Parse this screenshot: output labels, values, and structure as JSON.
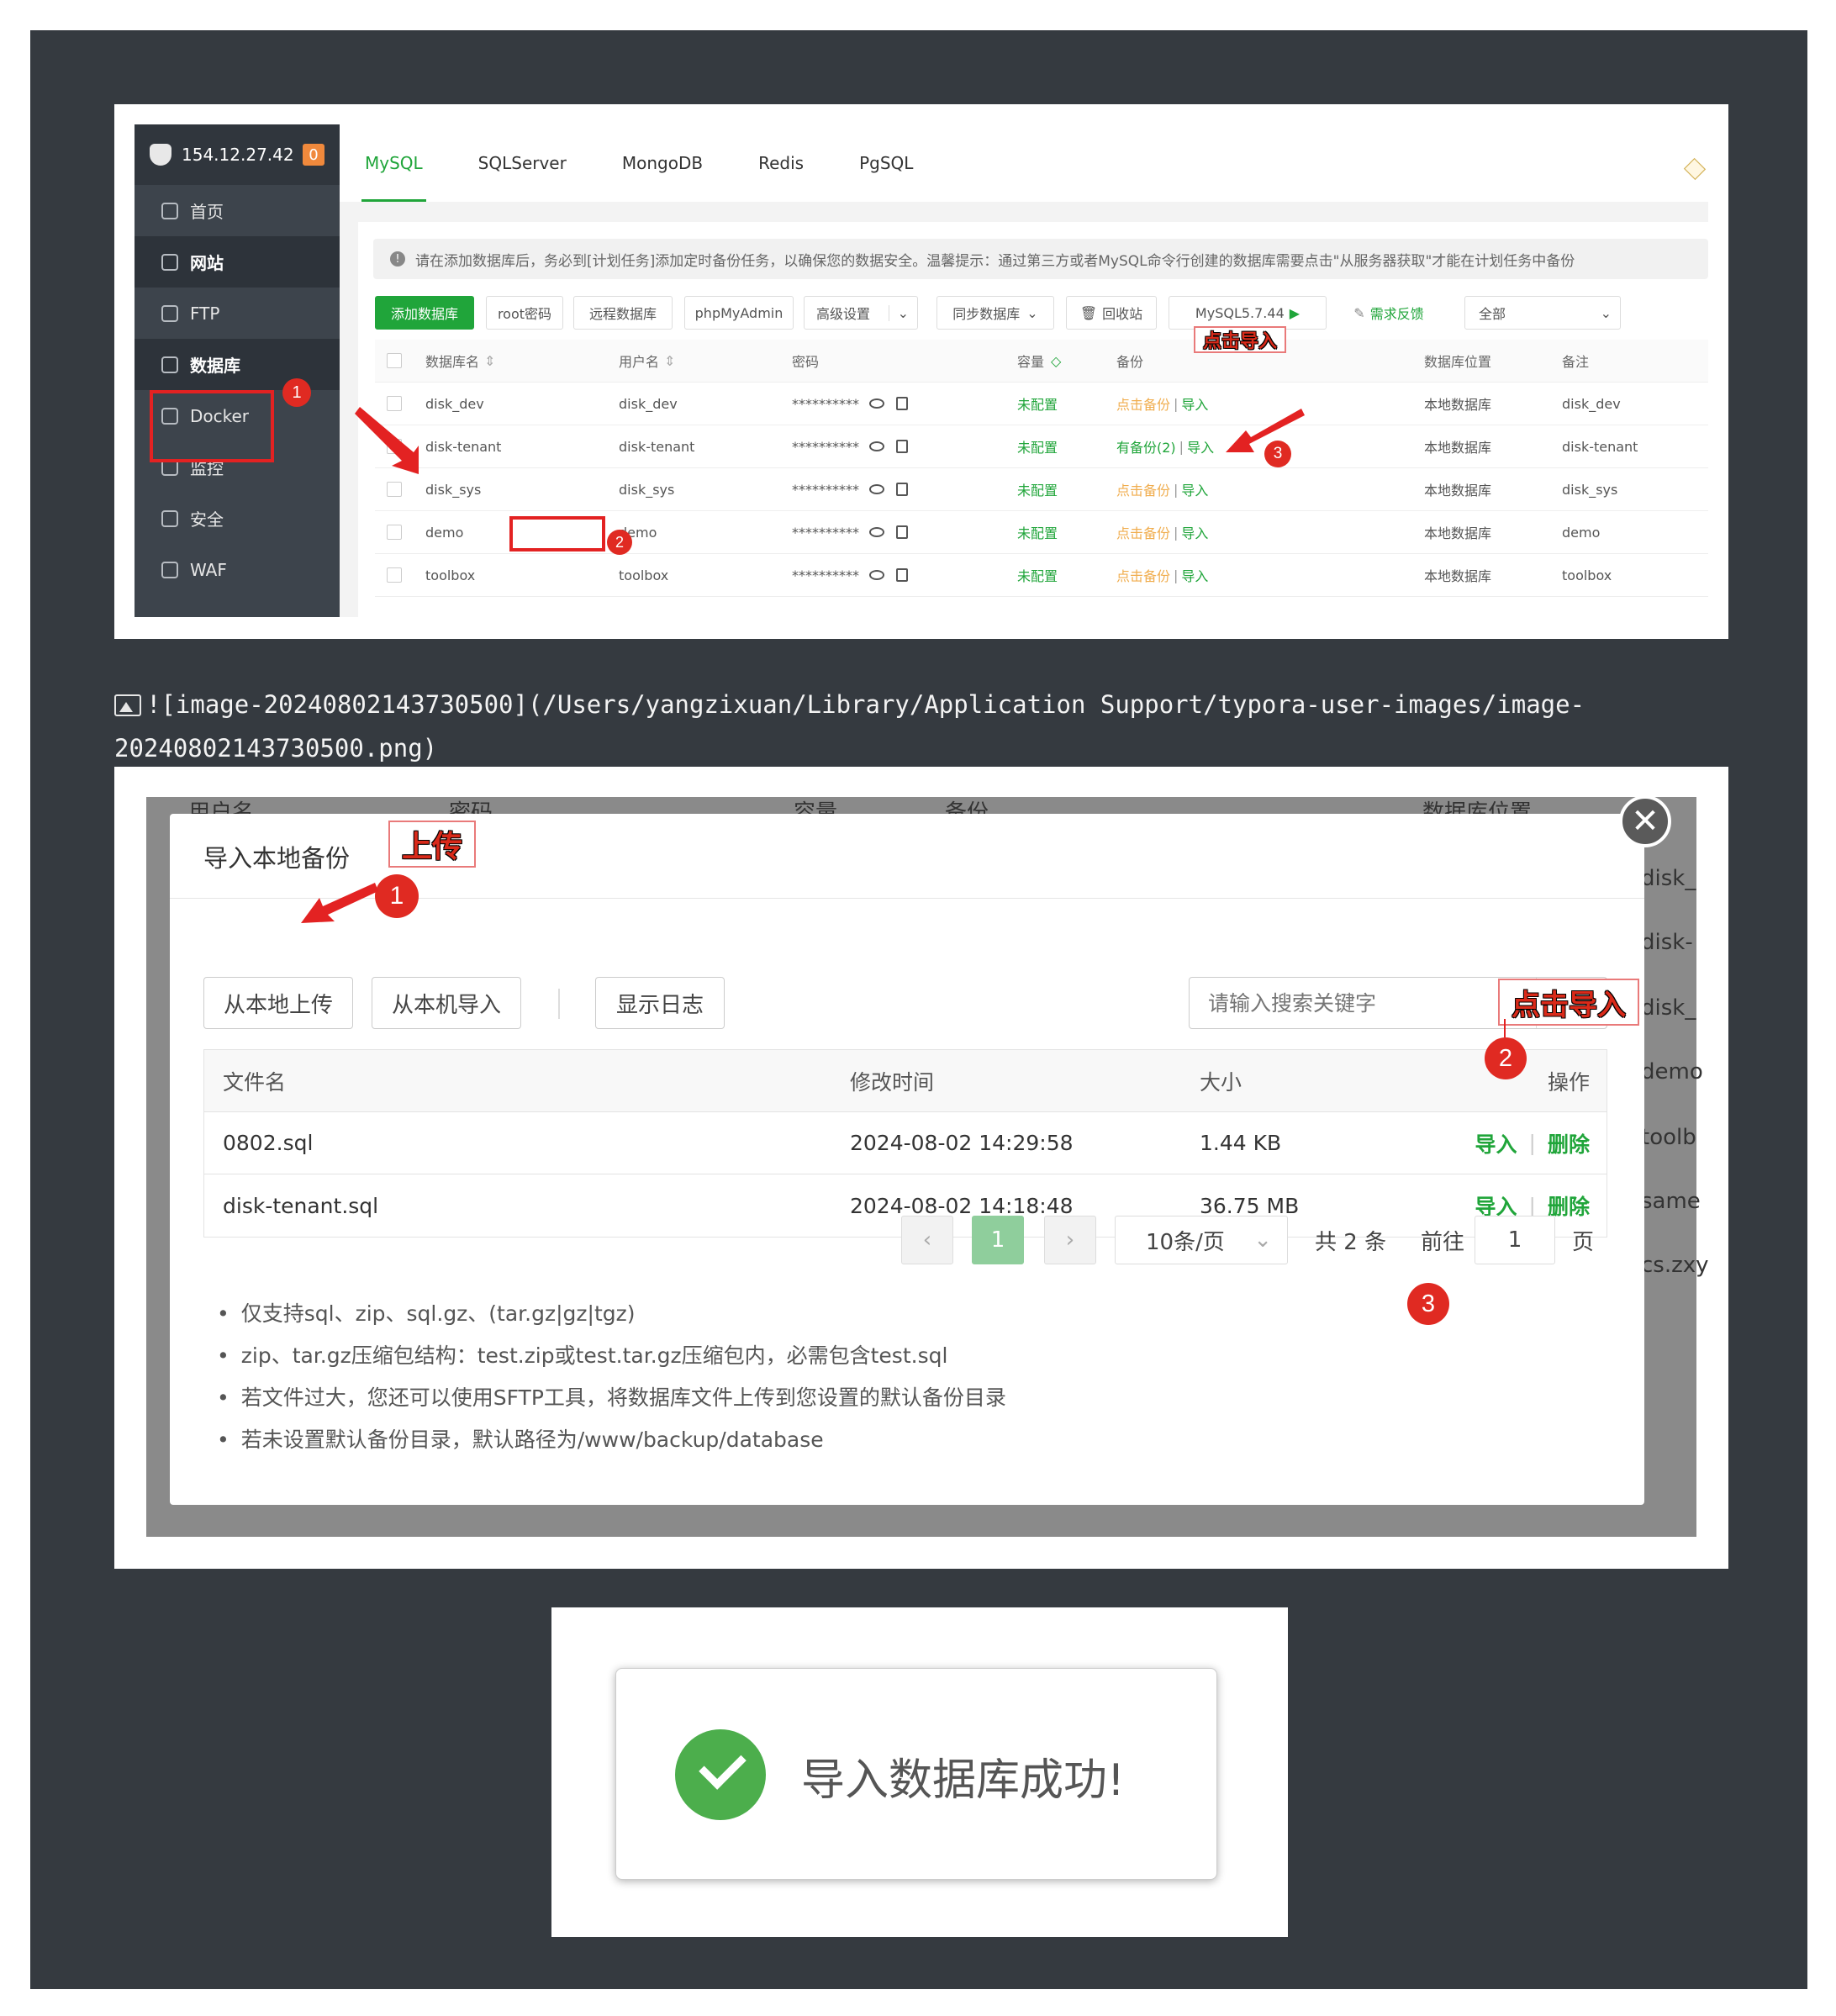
{
  "shot1": {
    "server_ip": "154.12.27.42",
    "alert_badge": "0",
    "nav": [
      {
        "label": "首页",
        "icon": "home-icon"
      },
      {
        "label": "网站",
        "icon": "globe-icon"
      },
      {
        "label": "FTP",
        "icon": "ftp-icon"
      },
      {
        "label": "数据库",
        "icon": "database-icon"
      },
      {
        "label": "Docker",
        "icon": "docker-icon"
      },
      {
        "label": "监控",
        "icon": "monitor-icon"
      },
      {
        "label": "安全",
        "icon": "shield-icon"
      },
      {
        "label": "WAF",
        "icon": "waf-icon"
      }
    ],
    "tabs": [
      "MySQL",
      "SQLServer",
      "MongoDB",
      "Redis",
      "PgSQL"
    ],
    "notice": "请在添加数据库后，务必到[计划任务]添加定时备份任务，以确保您的数据安全。温馨提示：通过第三方或者MySQL命令行创建的数据库需要点击\"从服务器获取\"才能在计划任务中备份",
    "toolbar": {
      "add_db": "添加数据库",
      "root_pwd": "root密码",
      "remote_db": "远程数据库",
      "phpmyadmin": "phpMyAdmin",
      "advanced": "高级设置",
      "sync_db": "同步数据库",
      "recycle": "回收站",
      "mysql_version": "MySQL5.7.44",
      "feedback": "需求反馈",
      "filter_all": "全部"
    },
    "columns": [
      "数据库名",
      "用户名",
      "密码",
      "容量",
      "备份",
      "数据库位置",
      "备注"
    ],
    "rows": [
      {
        "name": "disk_dev",
        "user": "disk_dev",
        "pwd": "**********",
        "cap": "未配置",
        "backup": "点击备份",
        "import": "导入",
        "loc": "本地数据库",
        "note": "disk_dev"
      },
      {
        "name": "disk-tenant",
        "user": "disk-tenant",
        "pwd": "**********",
        "cap": "未配置",
        "backup": "有备份(2)",
        "import": "导入",
        "loc": "本地数据库",
        "note": "disk-tenant"
      },
      {
        "name": "disk_sys",
        "user": "disk_sys",
        "pwd": "**********",
        "cap": "未配置",
        "backup": "点击备份",
        "import": "导入",
        "loc": "本地数据库",
        "note": "disk_sys"
      },
      {
        "name": "demo",
        "user": "demo",
        "pwd": "**********",
        "cap": "未配置",
        "backup": "点击备份",
        "import": "导入",
        "loc": "本地数据库",
        "note": "demo"
      },
      {
        "name": "toolbox",
        "user": "toolbox",
        "pwd": "**********",
        "cap": "未配置",
        "backup": "点击备份",
        "import": "导入",
        "loc": "本地数据库",
        "note": "toolbox"
      }
    ],
    "callout_import": "点击导入",
    "step1": "1",
    "step2": "2",
    "step3": "3",
    "accent": "#20a53a",
    "annotation_red": "#e32222"
  },
  "markdown_line": "![image-20240802143730500](/Users/yangzixuan/Library/Application Support/typora-user-images/image-20240802143730500.png)",
  "shot2": {
    "bg_peek": {
      "header_user": "用户名",
      "header_pwd": "密码",
      "header_cap": "容量",
      "header_backup": "备份",
      "header_loc": "数据库位置",
      "right_items": [
        "disk_",
        "disk-",
        "disk_",
        "demo",
        "toolb",
        "same",
        "cs.zxy"
      ]
    },
    "close_glyph": "✕",
    "title": "导入本地备份",
    "callout_upload": "上传",
    "callout_import": "点击导入",
    "step1": "1",
    "step2": "2",
    "step3": "3",
    "buttons": {
      "upload_local": "从本地上传",
      "import_server": "从本机导入",
      "show_log": "显示日志"
    },
    "search_placeholder": "请输入搜索关键字",
    "columns": [
      "文件名",
      "修改时间",
      "大小",
      "操作"
    ],
    "files": [
      {
        "name": "0802.sql",
        "mtime": "2024-08-02 14:29:58",
        "size": "1.44 KB",
        "op_import": "导入",
        "op_delete": "删除"
      },
      {
        "name": "disk-tenant.sql",
        "mtime": "2024-08-02 14:18:48",
        "size": "36.75 MB",
        "op_import": "导入",
        "op_delete": "删除"
      }
    ],
    "pager": {
      "prev": "‹",
      "current": "1",
      "next": "›",
      "page_size": "10条/页",
      "total": "共 2 条",
      "goto_label": "前往",
      "goto_value": "1",
      "page_unit": "页"
    },
    "notes": [
      "仅支持sql、zip、sql.gz、(tar.gz|gz|tgz)",
      "zip、tar.gz压缩包结构：test.zip或test.tar.gz压缩包内，必需包含test.sql",
      "若文件过大，您还可以使用SFTP工具，将数据库文件上传到您设置的默认备份目录",
      "若未设置默认备份目录，默认路径为/www/backup/database"
    ]
  },
  "shot3": {
    "message": "导入数据库成功!"
  }
}
